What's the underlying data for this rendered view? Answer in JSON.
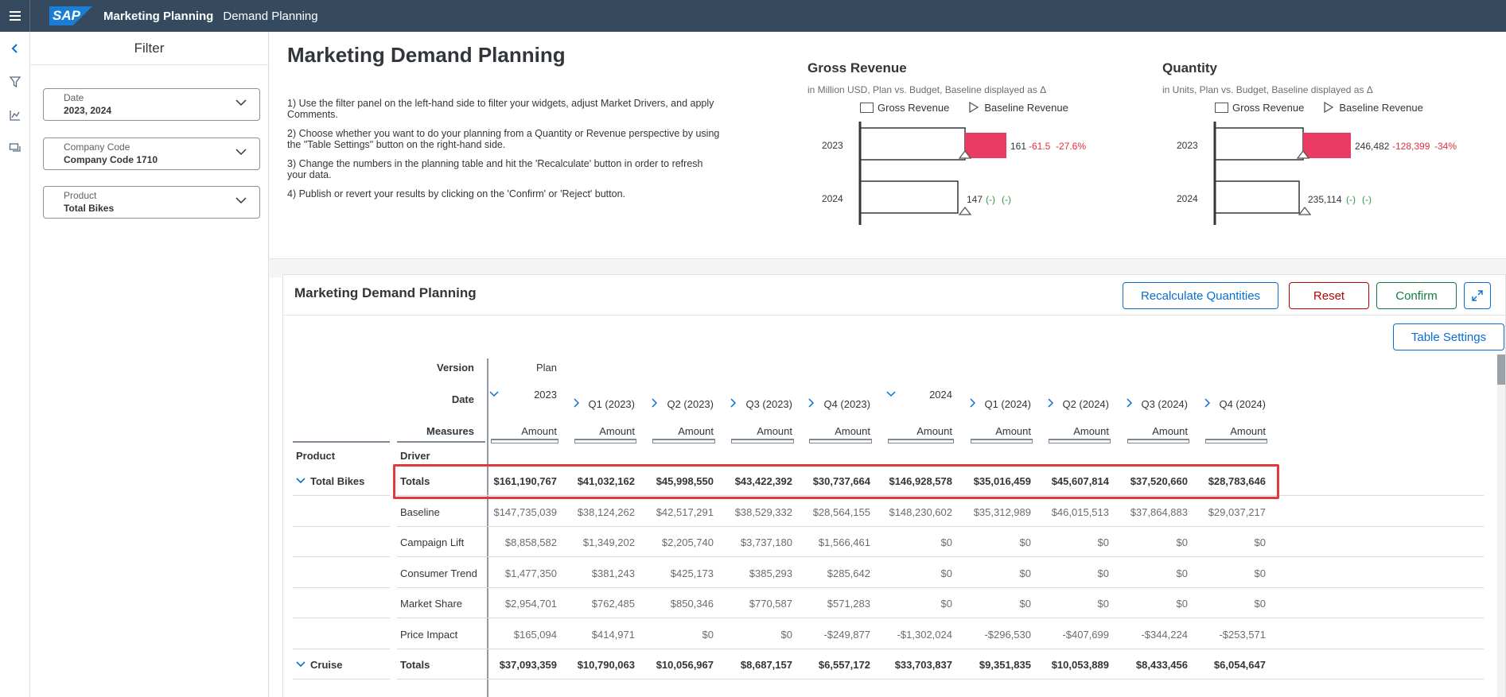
{
  "shell": {
    "logo": "SAP",
    "title": "Marketing Planning",
    "subtitle": "Demand Planning"
  },
  "rail": {
    "icons": [
      "back-icon",
      "filter-icon",
      "chart-icon",
      "comments-icon"
    ]
  },
  "filter": {
    "title": "Filter",
    "fields": [
      {
        "label": "Date",
        "value": "2023, 2024"
      },
      {
        "label": "Company Code",
        "value": "Company Code 1710"
      },
      {
        "label": "Product",
        "value": "Total Bikes"
      }
    ]
  },
  "main": {
    "title": "Marketing Demand Planning",
    "instructions": [
      "1) Use the filter panel on the left-hand side to filter your widgets, adjust Market Drivers, and apply Comments.",
      "2) Choose whether you want to do your planning from a Quantity or Revenue perspective by using the \"Table Settings\" button on the right-hand side.",
      "3) Change the numbers in the planning table and hit the 'Recalculate' button in order to refresh your data.",
      "4) Publish or revert your results by clicking on the 'Confirm' or 'Reject' button."
    ]
  },
  "charts": [
    {
      "title": "Gross Revenue",
      "subtitle": "in Million USD, Plan vs. Budget, Baseline displayed as Δ",
      "legend": [
        "Gross Revenue",
        "Baseline Revenue"
      ],
      "rows": [
        {
          "year": "2023",
          "value": "161",
          "delta": "-61.5",
          "pct": "-27.6%",
          "neg": true
        },
        {
          "year": "2024",
          "value": "147",
          "delta": "(-)",
          "pct": "(-)",
          "neg": false
        }
      ]
    },
    {
      "title": "Quantity",
      "subtitle": "in Units, Plan vs. Budget, Baseline displayed as Δ",
      "legend": [
        "Gross Revenue",
        "Baseline Revenue"
      ],
      "rows": [
        {
          "year": "2023",
          "value": "246,482",
          "delta": "-128,399",
          "pct": "-34%",
          "neg": true
        },
        {
          "year": "2024",
          "value": "235,114",
          "delta": "(-)",
          "pct": "(-)",
          "neg": false
        }
      ]
    }
  ],
  "chart_data": [
    {
      "type": "bar",
      "title": "Gross Revenue",
      "categories": [
        "2023",
        "2024"
      ],
      "series": [
        {
          "name": "Gross Revenue",
          "values": [
            161,
            147
          ]
        },
        {
          "name": "Baseline Revenue",
          "values": [
            161,
            147
          ]
        }
      ],
      "variance": [
        -61.5,
        null
      ]
    },
    {
      "type": "bar",
      "title": "Quantity",
      "categories": [
        "2023",
        "2024"
      ],
      "series": [
        {
          "name": "Gross Revenue",
          "values": [
            246482,
            235114
          ]
        },
        {
          "name": "Baseline Revenue",
          "values": [
            246482,
            235114
          ]
        }
      ],
      "variance": [
        -128399,
        null
      ]
    }
  ],
  "card": {
    "title": "Marketing Demand Planning",
    "buttons": {
      "recalc": "Recalculate Quantities",
      "reset": "Reset",
      "confirm": "Confirm",
      "settings": "Table Settings"
    }
  },
  "table": {
    "header_labels": {
      "version": "Version",
      "date": "Date",
      "measures": "Measures",
      "product": "Product",
      "driver": "Driver"
    },
    "version": "Plan",
    "columns": [
      {
        "label": "2023",
        "toggle": "v"
      },
      {
        "label": "Q1 (2023)",
        "toggle": ">"
      },
      {
        "label": "Q2 (2023)",
        "toggle": ">"
      },
      {
        "label": "Q3 (2023)",
        "toggle": ">"
      },
      {
        "label": "Q4 (2023)",
        "toggle": ">"
      },
      {
        "label": "2024",
        "toggle": "v"
      },
      {
        "label": "Q1 (2024)",
        "toggle": ">"
      },
      {
        "label": "Q2 (2024)",
        "toggle": ">"
      },
      {
        "label": "Q3 (2024)",
        "toggle": ">"
      },
      {
        "label": "Q4 (2024)",
        "toggle": ">"
      }
    ],
    "measure": "Amount",
    "rows": [
      {
        "product": "Total Bikes",
        "driver": "Totals",
        "bold": true,
        "values": [
          "$161,190,767",
          "$41,032,162",
          "$45,998,550",
          "$43,422,392",
          "$30,737,664",
          "$146,928,578",
          "$35,016,459",
          "$45,607,814",
          "$37,520,660",
          "$28,783,646"
        ]
      },
      {
        "product": "",
        "driver": "Baseline",
        "bold": false,
        "values": [
          "$147,735,039",
          "$38,124,262",
          "$42,517,291",
          "$38,529,332",
          "$28,564,155",
          "$148,230,602",
          "$35,312,989",
          "$46,015,513",
          "$37,864,883",
          "$29,037,217"
        ]
      },
      {
        "product": "",
        "driver": "Campaign Lift",
        "bold": false,
        "values": [
          "$8,858,582",
          "$1,349,202",
          "$2,205,740",
          "$3,737,180",
          "$1,566,461",
          "$0",
          "$0",
          "$0",
          "$0",
          "$0"
        ]
      },
      {
        "product": "",
        "driver": "Consumer Trend",
        "bold": false,
        "values": [
          "$1,477,350",
          "$381,243",
          "$425,173",
          "$385,293",
          "$285,642",
          "$0",
          "$0",
          "$0",
          "$0",
          "$0"
        ]
      },
      {
        "product": "",
        "driver": "Market Share",
        "bold": false,
        "values": [
          "$2,954,701",
          "$762,485",
          "$850,346",
          "$770,587",
          "$571,283",
          "$0",
          "$0",
          "$0",
          "$0",
          "$0"
        ]
      },
      {
        "product": "",
        "driver": "Price Impact",
        "bold": false,
        "values": [
          "$165,094",
          "$414,971",
          "$0",
          "$0",
          "-$249,877",
          "-$1,302,024",
          "-$296,530",
          "-$407,699",
          "-$344,224",
          "-$253,571"
        ]
      },
      {
        "product": "Cruise",
        "driver": "Totals",
        "bold": true,
        "values": [
          "$37,093,359",
          "$10,790,063",
          "$10,056,967",
          "$8,687,157",
          "$6,557,172",
          "$33,703,837",
          "$9,351,835",
          "$10,053,889",
          "$8,433,456",
          "$6,054,647"
        ]
      }
    ]
  }
}
